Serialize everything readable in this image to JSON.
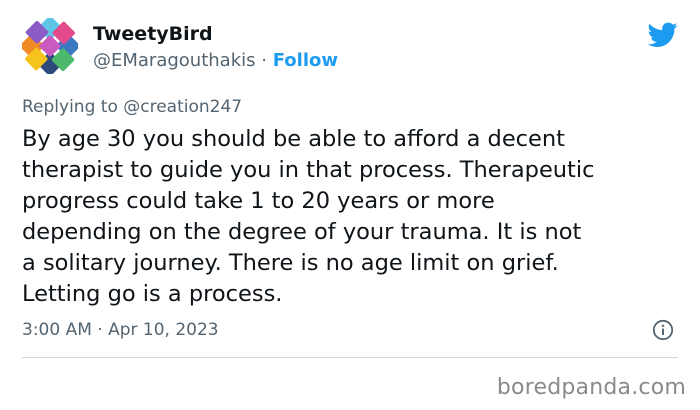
{
  "author": {
    "display_name": "TweetyBird",
    "handle": "@EMaragouthakis",
    "separator": "·",
    "follow_label": "Follow",
    "avatar_icon": "geometric-flower-logo"
  },
  "platform_icon": "twitter-bird-icon",
  "reply": {
    "prefix": "Replying to",
    "handle": "@creation247"
  },
  "tweet": {
    "lines": [
      "By age 30 you should be able to afford a decent",
      "therapist to guide you in that process. Therapeutic",
      "progress could take 1 to 20 years or more",
      "depending on the degree of your trauma. It is not",
      "a solitary journey. There is no age limit on grief.",
      "Letting go is a process."
    ]
  },
  "timestamp": "3:00 AM · Apr 10, 2023",
  "info_icon": "info-circle-icon",
  "watermark": "boredpanda.com",
  "colors": {
    "accent": "#1d9bf0",
    "secondary_text": "#536471",
    "primary_text": "#0f1419",
    "divider": "#cfd9de"
  }
}
